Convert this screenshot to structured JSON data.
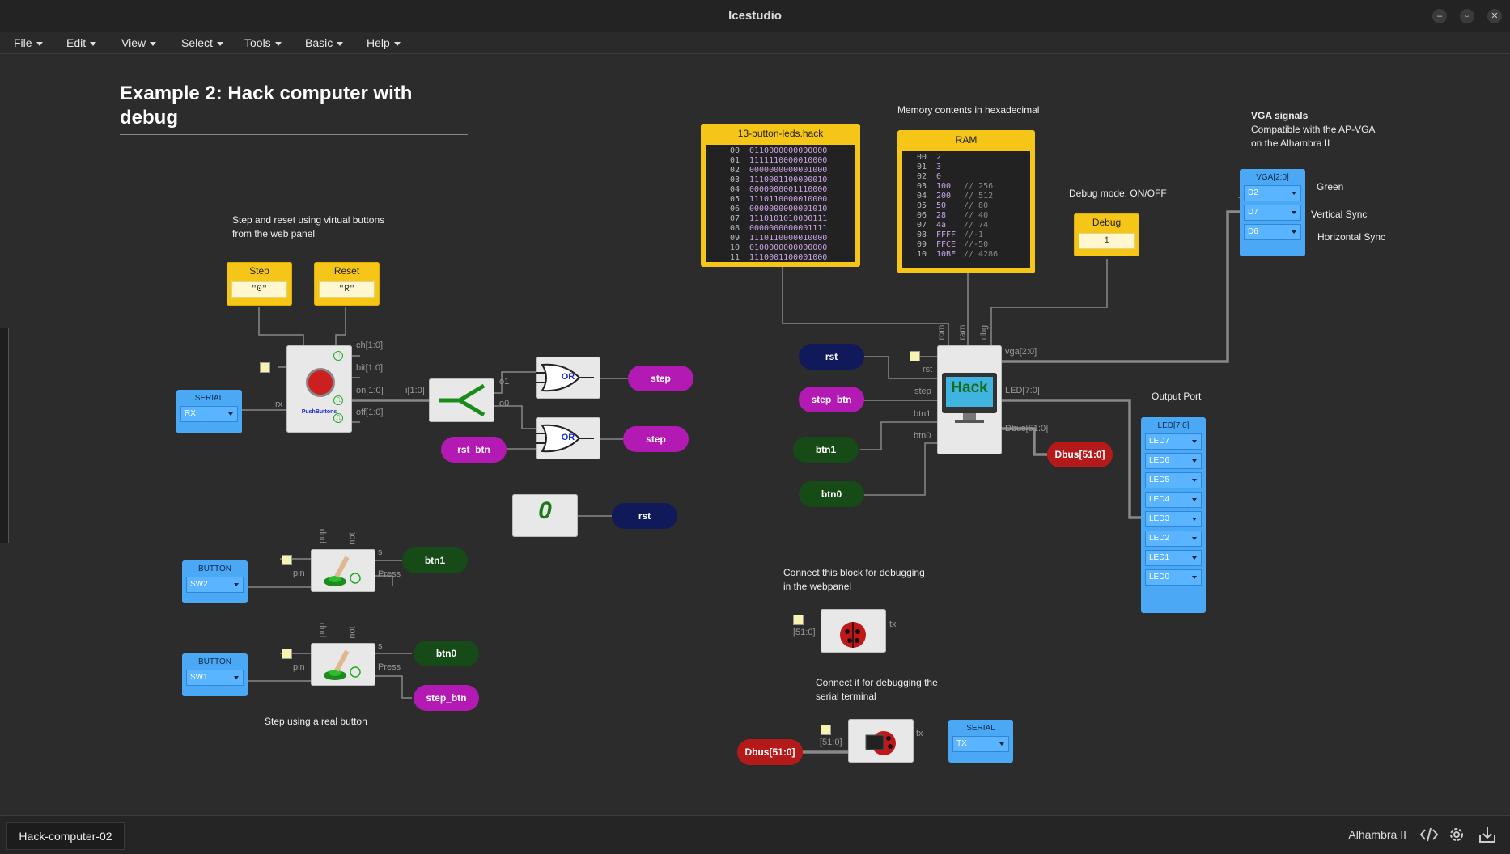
{
  "app": {
    "title": "Icestudio"
  },
  "menu": [
    "File",
    "Edit",
    "View",
    "Select",
    "Tools",
    "Basic",
    "Help"
  ],
  "page_title": "Example 2: Hack computer with debug",
  "notes": {
    "step_reset": "Step and reset using virtual buttons\nfrom the web panel",
    "real_button": "Step using a real button",
    "memory": "Memory contents in hexadecimal",
    "debug_mode": "Debug mode: ON/OFF",
    "vga_title": "VGA signals",
    "vga_sub": "Compatible with the AP-VGA\non the Alhambra II",
    "green": "Green",
    "vsync": "Vertical Sync",
    "hsync": "Horizontal Sync",
    "output_port": "Output Port",
    "debug_web": "Connect this block for debugging\nin the webpanel",
    "debug_serial": "Connect it for debugging the\nserial terminal"
  },
  "inputs_web": {
    "step_title": "Step",
    "step_value": "\"0\"",
    "reset_title": "Reset",
    "reset_value": "\"R\""
  },
  "debug_input": {
    "title": "Debug",
    "value": "1"
  },
  "rom": {
    "title": "13-button-leds.hack",
    "rows": [
      [
        "00",
        "0110000000000000"
      ],
      [
        "01",
        "1111110000010000"
      ],
      [
        "02",
        "0000000000001000"
      ],
      [
        "03",
        "1110001100000010"
      ],
      [
        "04",
        "0000000001110000"
      ],
      [
        "05",
        "1110110000010000"
      ],
      [
        "06",
        "0000000000001010"
      ],
      [
        "07",
        "1110101010000111"
      ],
      [
        "08",
        "0000000000001111"
      ],
      [
        "09",
        "1110110000010000"
      ],
      [
        "10",
        "0100000000000000"
      ],
      [
        "11",
        "1110001100001000"
      ]
    ]
  },
  "ram": {
    "title": "RAM",
    "rows": [
      [
        "00",
        "2",
        ""
      ],
      [
        "01",
        "3",
        ""
      ],
      [
        "02",
        "0",
        ""
      ],
      [
        "03",
        "100",
        "// 256"
      ],
      [
        "04",
        "200",
        "// 512"
      ],
      [
        "05",
        "50",
        "// 80"
      ],
      [
        "06",
        "28",
        "// 40"
      ],
      [
        "07",
        "4a",
        "// 74"
      ],
      [
        "08",
        "FFFF",
        "//-1"
      ],
      [
        "09",
        "FFCE",
        "//-50"
      ],
      [
        "10",
        "10BE",
        "// 4286"
      ]
    ]
  },
  "serial_in": {
    "title": "SERIAL",
    "pin": "RX"
  },
  "serial_out": {
    "title": "SERIAL",
    "pin": "TX"
  },
  "button1": {
    "title": "BUTTON",
    "pin": "SW2"
  },
  "button2": {
    "title": "BUTTON",
    "pin": "SW1"
  },
  "vga": {
    "title": "VGA[2:0]",
    "pins": [
      "D2",
      "D7",
      "D6"
    ]
  },
  "leds": {
    "title": "LED[7:0]",
    "pins": [
      "LED7",
      "LED6",
      "LED5",
      "LED4",
      "LED3",
      "LED2",
      "LED1",
      "LED0"
    ]
  },
  "pills": {
    "step_a": "step",
    "step_b": "step",
    "rst_btn": "rst_btn",
    "rst": "rst",
    "rst2": "rst",
    "step_btn": "step_btn",
    "step_btn2": "step_btn",
    "btn1": "btn1",
    "btn1b": "btn1",
    "btn0": "btn0",
    "btn0b": "btn0",
    "dbus1": "Dbus[51:0]",
    "dbus2": "Dbus[51:0]"
  },
  "gates": {
    "or": "OR",
    "const": "0",
    "hack": "Hack",
    "pushbuttons": "PushButtons"
  },
  "port_labels": {
    "ch": "ch[1:0]",
    "bit": "bit[1:0]",
    "on": "on[1:0]",
    "off": "off[1:0]",
    "rx": "rx",
    "i": "i[1:0]",
    "o1": "o1",
    "o0": "o0",
    "rom": "rom",
    "ram": "ram",
    "dbg": "dbg",
    "rst": "rst",
    "step": "step",
    "btn1": "btn1",
    "btn0": "btn0",
    "vga": "vga[2:0]",
    "led": "LED[7:0]",
    "dbus": "Dbus[51:0]",
    "pup": "pup",
    "not": "not",
    "pin": "pin",
    "s": "s",
    "press": "Press",
    "d51": "[51:0]",
    "tx": "tx"
  },
  "footer": {
    "project": "Hack-computer-02",
    "board": "Alhambra II"
  },
  "colors": {
    "yellow": "#f5c518",
    "blue": "#4aa8f5",
    "magenta": "#b31ab3",
    "green": "#164a16",
    "navy": "#101a5a",
    "red": "#b51a1a"
  }
}
